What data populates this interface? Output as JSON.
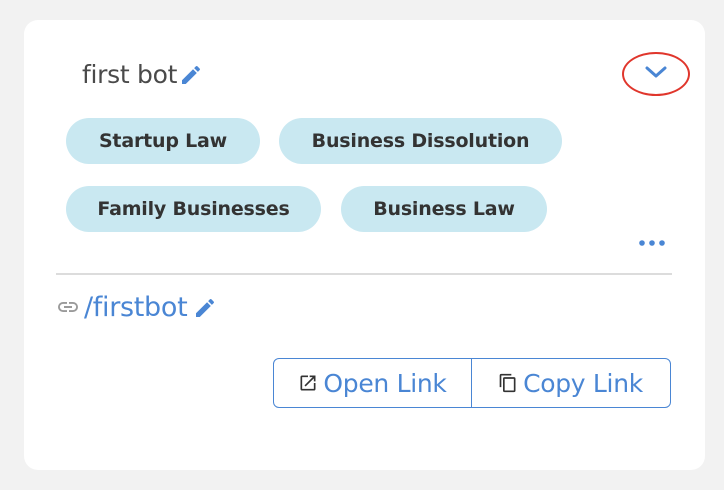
{
  "bot": {
    "name": "first bot",
    "edit_icon": "pencil-icon",
    "expand_icon": "chevron-down-icon"
  },
  "tags": [
    {
      "label": "Startup Law"
    },
    {
      "label": "Business Dissolution"
    },
    {
      "label": "Family Businesses"
    },
    {
      "label": "Business Law"
    }
  ],
  "more_icon": "ellipsis-icon",
  "link": {
    "icon": "link-icon",
    "slug": "/firstbot",
    "edit_icon": "pencil-icon"
  },
  "actions": {
    "open_label": "Open Link",
    "open_icon": "external-link-icon",
    "copy_label": "Copy Link",
    "copy_icon": "copy-icon"
  },
  "colors": {
    "accent": "#4a86d4",
    "chip_bg": "#c9e8f1",
    "highlight_ring": "#e0362c",
    "card_bg": "#ffffff",
    "page_bg": "#f2f2f2"
  }
}
